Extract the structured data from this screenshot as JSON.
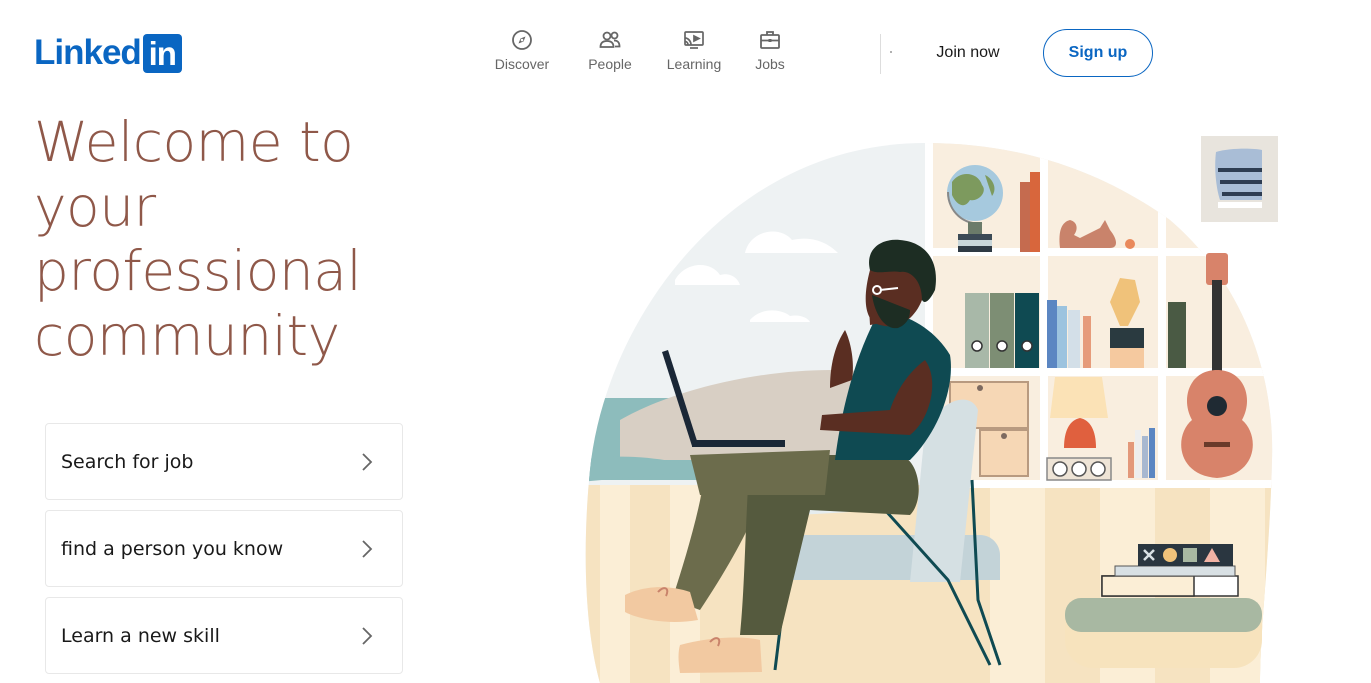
{
  "brand": {
    "logo_text": "Linked",
    "logo_box_text": "in",
    "accent": "#0a66c2",
    "title_color": "#8f5849"
  },
  "nav": {
    "items": [
      {
        "label": "Discover",
        "icon": "compass-icon"
      },
      {
        "label": "People",
        "icon": "people-icon"
      },
      {
        "label": "Learning",
        "icon": "learning-icon"
      },
      {
        "label": "Jobs",
        "icon": "briefcase-icon"
      }
    ],
    "join_label": "Join now",
    "signup_label": "Sign up"
  },
  "hero": {
    "title_lines": [
      "Welcome to",
      "your",
      "professional",
      "community"
    ],
    "options": [
      {
        "label": "Search for job",
        "icon": "chevron-right-icon"
      },
      {
        "label": "find a person you know",
        "icon": "chevron-right-icon"
      },
      {
        "label": "Learn a new skill",
        "icon": "chevron-right-icon"
      }
    ]
  }
}
